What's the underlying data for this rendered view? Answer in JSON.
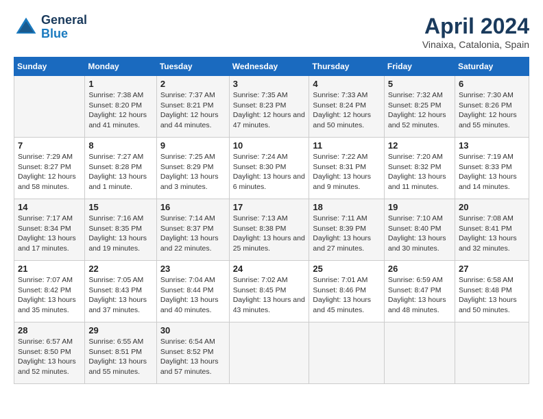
{
  "logo": {
    "text_general": "General",
    "text_blue": "Blue"
  },
  "title": "April 2024",
  "location": "Vinaixa, Catalonia, Spain",
  "weekdays": [
    "Sunday",
    "Monday",
    "Tuesday",
    "Wednesday",
    "Thursday",
    "Friday",
    "Saturday"
  ],
  "weeks": [
    [
      {
        "day": "",
        "sunrise": "",
        "sunset": "",
        "daylight": ""
      },
      {
        "day": "1",
        "sunrise": "Sunrise: 7:38 AM",
        "sunset": "Sunset: 8:20 PM",
        "daylight": "Daylight: 12 hours and 41 minutes."
      },
      {
        "day": "2",
        "sunrise": "Sunrise: 7:37 AM",
        "sunset": "Sunset: 8:21 PM",
        "daylight": "Daylight: 12 hours and 44 minutes."
      },
      {
        "day": "3",
        "sunrise": "Sunrise: 7:35 AM",
        "sunset": "Sunset: 8:23 PM",
        "daylight": "Daylight: 12 hours and 47 minutes."
      },
      {
        "day": "4",
        "sunrise": "Sunrise: 7:33 AM",
        "sunset": "Sunset: 8:24 PM",
        "daylight": "Daylight: 12 hours and 50 minutes."
      },
      {
        "day": "5",
        "sunrise": "Sunrise: 7:32 AM",
        "sunset": "Sunset: 8:25 PM",
        "daylight": "Daylight: 12 hours and 52 minutes."
      },
      {
        "day": "6",
        "sunrise": "Sunrise: 7:30 AM",
        "sunset": "Sunset: 8:26 PM",
        "daylight": "Daylight: 12 hours and 55 minutes."
      }
    ],
    [
      {
        "day": "7",
        "sunrise": "Sunrise: 7:29 AM",
        "sunset": "Sunset: 8:27 PM",
        "daylight": "Daylight: 12 hours and 58 minutes."
      },
      {
        "day": "8",
        "sunrise": "Sunrise: 7:27 AM",
        "sunset": "Sunset: 8:28 PM",
        "daylight": "Daylight: 13 hours and 1 minute."
      },
      {
        "day": "9",
        "sunrise": "Sunrise: 7:25 AM",
        "sunset": "Sunset: 8:29 PM",
        "daylight": "Daylight: 13 hours and 3 minutes."
      },
      {
        "day": "10",
        "sunrise": "Sunrise: 7:24 AM",
        "sunset": "Sunset: 8:30 PM",
        "daylight": "Daylight: 13 hours and 6 minutes."
      },
      {
        "day": "11",
        "sunrise": "Sunrise: 7:22 AM",
        "sunset": "Sunset: 8:31 PM",
        "daylight": "Daylight: 13 hours and 9 minutes."
      },
      {
        "day": "12",
        "sunrise": "Sunrise: 7:20 AM",
        "sunset": "Sunset: 8:32 PM",
        "daylight": "Daylight: 13 hours and 11 minutes."
      },
      {
        "day": "13",
        "sunrise": "Sunrise: 7:19 AM",
        "sunset": "Sunset: 8:33 PM",
        "daylight": "Daylight: 13 hours and 14 minutes."
      }
    ],
    [
      {
        "day": "14",
        "sunrise": "Sunrise: 7:17 AM",
        "sunset": "Sunset: 8:34 PM",
        "daylight": "Daylight: 13 hours and 17 minutes."
      },
      {
        "day": "15",
        "sunrise": "Sunrise: 7:16 AM",
        "sunset": "Sunset: 8:35 PM",
        "daylight": "Daylight: 13 hours and 19 minutes."
      },
      {
        "day": "16",
        "sunrise": "Sunrise: 7:14 AM",
        "sunset": "Sunset: 8:37 PM",
        "daylight": "Daylight: 13 hours and 22 minutes."
      },
      {
        "day": "17",
        "sunrise": "Sunrise: 7:13 AM",
        "sunset": "Sunset: 8:38 PM",
        "daylight": "Daylight: 13 hours and 25 minutes."
      },
      {
        "day": "18",
        "sunrise": "Sunrise: 7:11 AM",
        "sunset": "Sunset: 8:39 PM",
        "daylight": "Daylight: 13 hours and 27 minutes."
      },
      {
        "day": "19",
        "sunrise": "Sunrise: 7:10 AM",
        "sunset": "Sunset: 8:40 PM",
        "daylight": "Daylight: 13 hours and 30 minutes."
      },
      {
        "day": "20",
        "sunrise": "Sunrise: 7:08 AM",
        "sunset": "Sunset: 8:41 PM",
        "daylight": "Daylight: 13 hours and 32 minutes."
      }
    ],
    [
      {
        "day": "21",
        "sunrise": "Sunrise: 7:07 AM",
        "sunset": "Sunset: 8:42 PM",
        "daylight": "Daylight: 13 hours and 35 minutes."
      },
      {
        "day": "22",
        "sunrise": "Sunrise: 7:05 AM",
        "sunset": "Sunset: 8:43 PM",
        "daylight": "Daylight: 13 hours and 37 minutes."
      },
      {
        "day": "23",
        "sunrise": "Sunrise: 7:04 AM",
        "sunset": "Sunset: 8:44 PM",
        "daylight": "Daylight: 13 hours and 40 minutes."
      },
      {
        "day": "24",
        "sunrise": "Sunrise: 7:02 AM",
        "sunset": "Sunset: 8:45 PM",
        "daylight": "Daylight: 13 hours and 43 minutes."
      },
      {
        "day": "25",
        "sunrise": "Sunrise: 7:01 AM",
        "sunset": "Sunset: 8:46 PM",
        "daylight": "Daylight: 13 hours and 45 minutes."
      },
      {
        "day": "26",
        "sunrise": "Sunrise: 6:59 AM",
        "sunset": "Sunset: 8:47 PM",
        "daylight": "Daylight: 13 hours and 48 minutes."
      },
      {
        "day": "27",
        "sunrise": "Sunrise: 6:58 AM",
        "sunset": "Sunset: 8:48 PM",
        "daylight": "Daylight: 13 hours and 50 minutes."
      }
    ],
    [
      {
        "day": "28",
        "sunrise": "Sunrise: 6:57 AM",
        "sunset": "Sunset: 8:50 PM",
        "daylight": "Daylight: 13 hours and 52 minutes."
      },
      {
        "day": "29",
        "sunrise": "Sunrise: 6:55 AM",
        "sunset": "Sunset: 8:51 PM",
        "daylight": "Daylight: 13 hours and 55 minutes."
      },
      {
        "day": "30",
        "sunrise": "Sunrise: 6:54 AM",
        "sunset": "Sunset: 8:52 PM",
        "daylight": "Daylight: 13 hours and 57 minutes."
      },
      {
        "day": "",
        "sunrise": "",
        "sunset": "",
        "daylight": ""
      },
      {
        "day": "",
        "sunrise": "",
        "sunset": "",
        "daylight": ""
      },
      {
        "day": "",
        "sunrise": "",
        "sunset": "",
        "daylight": ""
      },
      {
        "day": "",
        "sunrise": "",
        "sunset": "",
        "daylight": ""
      }
    ]
  ]
}
